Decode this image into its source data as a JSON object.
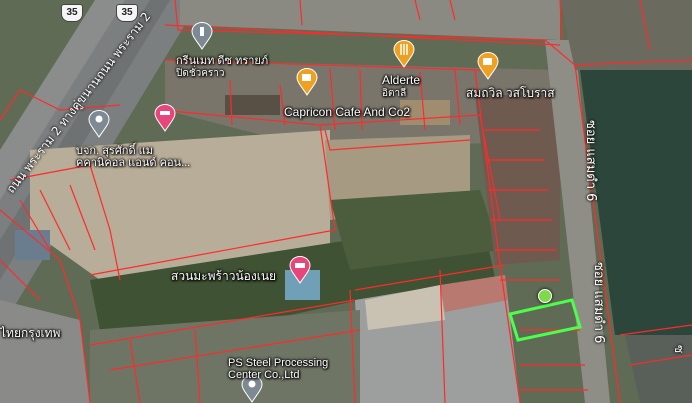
{
  "map": {
    "colors": {
      "parcel_line": "#ff2a2a",
      "selected_parcel": "#4cff4c",
      "poi_orange": "#f0a020",
      "poi_pink": "#e8457a",
      "poi_gray": "#7d8a94"
    },
    "roads": {
      "highway": "ถนน พระราม 2 ทางคู่ขนานถนน พระราม 2",
      "soi_a": "ซอย แสมดำ 6",
      "soi_b": "ซอย แสมดำ 6",
      "far_right": "ซ"
    },
    "shields": {
      "left": "35",
      "right": "35"
    },
    "places": [
      {
        "icon": "pin-icon",
        "line1": "กรีนเมท ดีซ ทรายภ์",
        "line2": "ปิดชั่วคราว"
      },
      {
        "icon": "cafe-icon",
        "line1": "Capricon Cafe And Co2",
        "line2": ""
      },
      {
        "icon": "restaurant-icon",
        "line1": "Alderte",
        "line2": "อิตาลี"
      },
      {
        "icon": "cafe-icon",
        "line1": "สมถวิล วสโบราส",
        "line2": ""
      },
      {
        "icon": "pin-icon",
        "line1": "บจก. สุรศักดิ์ แม",
        "line2": "คคานิคอล แอนด์ คอน..."
      },
      {
        "icon": "hotel-icon",
        "line1": "สวนมะพร้าวน้องเนย",
        "line2": ""
      },
      {
        "icon": "pin-icon",
        "line1": "PS Steel Processing",
        "line2": "Center Co.,Ltd"
      },
      {
        "icon": "text",
        "line1": "ไทยกรุงเทพ",
        "line2": ""
      }
    ]
  }
}
